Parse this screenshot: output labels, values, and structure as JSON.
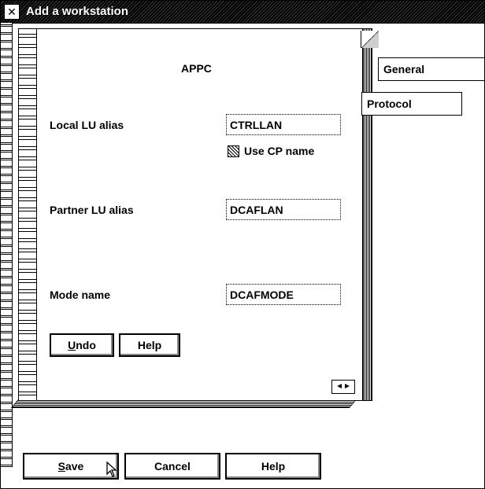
{
  "window": {
    "title": "Add a workstation",
    "sysmenu_icon": "system-menu-icon"
  },
  "page": {
    "title": "APPC",
    "local_lu_label": "Local LU alias",
    "local_lu_value": "CTRLLAN",
    "use_cp_label": "Use CP name",
    "partner_lu_label": "Partner LU alias",
    "partner_lu_value": "DCAFLAN",
    "mode_label": "Mode name",
    "mode_value": "DCAFMODE",
    "undo_mnemonic": "U",
    "undo_rest": "ndo",
    "help_label": "Help"
  },
  "tabs": [
    {
      "label": "General"
    },
    {
      "label": "Protocol"
    }
  ],
  "footer": {
    "save_mnemonic": "S",
    "save_rest": "ave",
    "cancel_label": "Cancel",
    "help_label": "Help"
  }
}
